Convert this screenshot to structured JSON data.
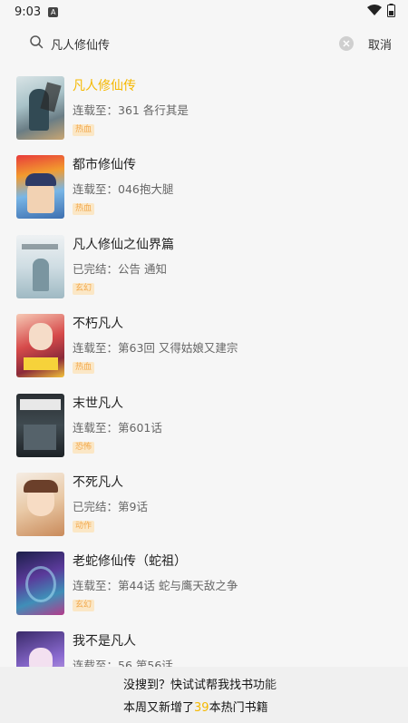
{
  "status_bar": {
    "time": "9:03",
    "app_indicator": "A"
  },
  "search": {
    "query": "凡人修仙传",
    "cancel_label": "取消"
  },
  "results": [
    {
      "title": "凡人修仙传",
      "progress": "连载至：361 各行其是",
      "tag": "热血",
      "active": true
    },
    {
      "title": "都市修仙传",
      "progress": "连载至：046抱大腿",
      "tag": "热血",
      "active": false
    },
    {
      "title": "凡人修仙之仙界篇",
      "progress": "已完结：公告 通知",
      "tag": "玄幻",
      "active": false
    },
    {
      "title": "不朽凡人",
      "progress": "连载至：第63回 又得姑娘又建宗",
      "tag": "热血",
      "active": false
    },
    {
      "title": "末世凡人",
      "progress": "连载至：第601话",
      "tag": "恐怖",
      "active": false
    },
    {
      "title": "不死凡人",
      "progress": "已完结：第9话",
      "tag": "动作",
      "active": false
    },
    {
      "title": "老蛇修仙传（蛇祖）",
      "progress": "连载至：第44话 蛇与鹰天敌之争",
      "tag": "玄幻",
      "active": false
    },
    {
      "title": "我不是凡人",
      "progress": "连载至：56 第56话",
      "tag": "",
      "active": false
    }
  ],
  "banner": {
    "line1": "没搜到？快试试帮我找书功能",
    "line2_prefix": "本周又新增了",
    "line2_count": "39",
    "line2_suffix": "本热门书籍"
  },
  "colors": {
    "accent": "#f5b800",
    "tag_bg": "#fbe7c6",
    "tag_text": "#f2a84b"
  }
}
